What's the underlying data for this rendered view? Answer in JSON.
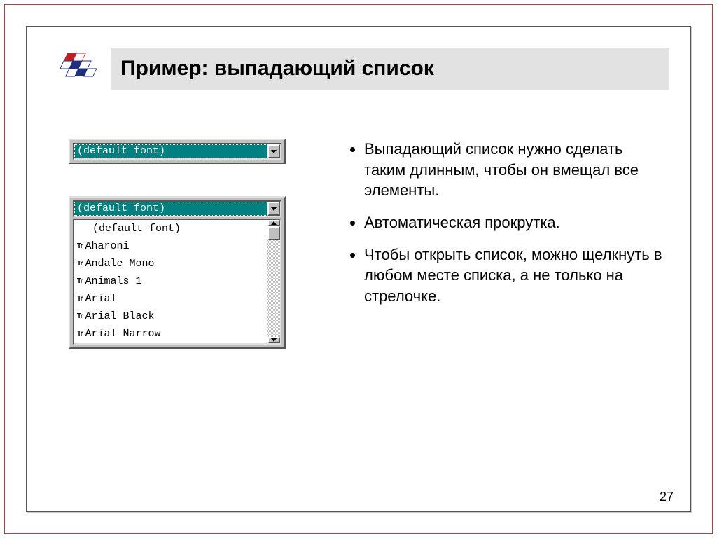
{
  "header": {
    "title": "Пример: выпадающий список"
  },
  "combo1": {
    "value": "(default font)"
  },
  "combo2": {
    "value": "(default font)",
    "items": [
      {
        "icon": "",
        "label": "(default font)"
      },
      {
        "icon": "Tr",
        "label": "Aharoni"
      },
      {
        "icon": "Tr",
        "label": "Andale Mono"
      },
      {
        "icon": "Tr",
        "label": "Animals 1"
      },
      {
        "icon": "Tr",
        "label": "Arial"
      },
      {
        "icon": "Tr",
        "label": "Arial Black"
      },
      {
        "icon": "Tr",
        "label": "Arial Narrow"
      }
    ]
  },
  "bullets": [
    "Выпадающий список нужно сделать таким длинным, чтобы он вмещал все элементы.",
    "Автоматическая прокрутка.",
    "Чтобы открыть список, можно щелкнуть в любом месте списка, а не только на стрелочке."
  ],
  "page": "27"
}
